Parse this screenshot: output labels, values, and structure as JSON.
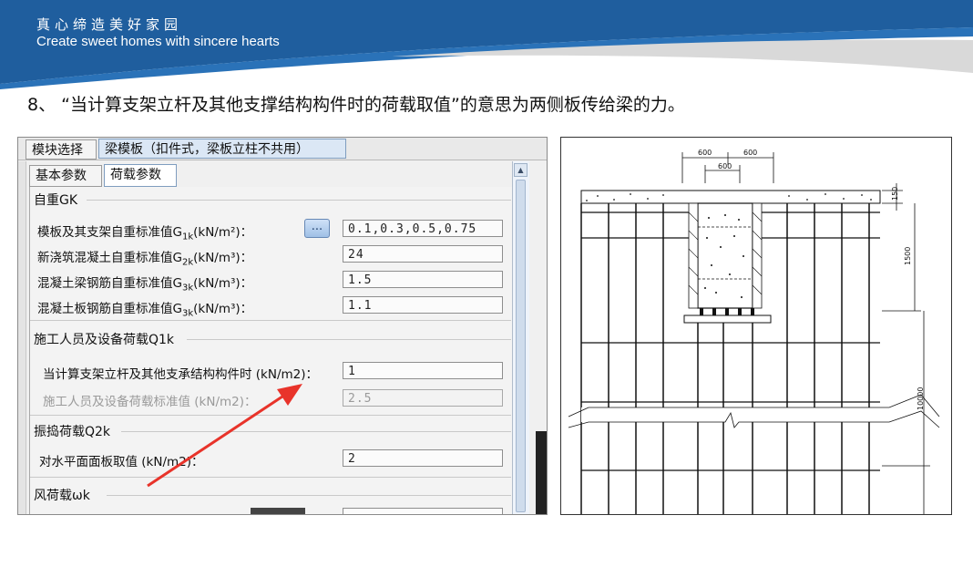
{
  "banner": {
    "slogan_cn": "真心缔造美好家园",
    "slogan_en": "Create sweet homes with sincere hearts",
    "colors": {
      "blue": "#1f5e9e",
      "light": "#d9d9d9"
    }
  },
  "heading": "8、 “当计算支架立杆及其他支撑结构构件时的荷载取值”的意思为两侧板传给梁的力。",
  "app": {
    "tabs": [
      {
        "label": "模块选择",
        "active": false
      },
      {
        "label": "梁模板（扣件式，梁板立柱不共用）",
        "active": true
      }
    ],
    "subtabs": [
      {
        "label": "基本参数",
        "active": false
      },
      {
        "label": "荷载参数",
        "active": true
      }
    ],
    "groups": {
      "gk": {
        "title": "自重GK",
        "rows": [
          {
            "label": "模板及其支架自重标准值",
            "sym": "G",
            "sub": "1k",
            "unit": "(kN/m²)：",
            "value": "0.1,0.3,0.5,0.75",
            "button": "..."
          },
          {
            "label": "新浇筑混凝土自重标准值",
            "sym": "G",
            "sub": "2k",
            "unit": "(kN/m³)：",
            "value": "24"
          },
          {
            "label": "混凝土梁钢筋自重标准值",
            "sym": "G",
            "sub": "3k",
            "unit": "(kN/m³)：",
            "value": "1.5"
          },
          {
            "label": "混凝土板钢筋自重标准值",
            "sym": "G",
            "sub": "3k",
            "unit": "(kN/m³)：",
            "value": "1.1"
          }
        ]
      },
      "q1k": {
        "title": "施工人员及设备荷载Q1k",
        "rows": [
          {
            "label": "当计算支架立杆及其他支承结构构件时 (kN/m2)：",
            "value": "1",
            "disabled": false
          },
          {
            "label": "施工人员及设备荷载标准值 (kN/m2)：",
            "value": "2.5",
            "disabled": true
          }
        ]
      },
      "q2k": {
        "title": "振捣荷载Q2k",
        "rows": [
          {
            "label": "对水平面面板取值 (kN/m2)：",
            "value": "2"
          }
        ]
      },
      "wk": {
        "title": "风荷载ωk"
      }
    },
    "annotation_color": "#e8332a"
  },
  "drawing": {
    "dims": [
      "600",
      "600",
      "600",
      "150",
      "1500",
      "10000"
    ]
  }
}
